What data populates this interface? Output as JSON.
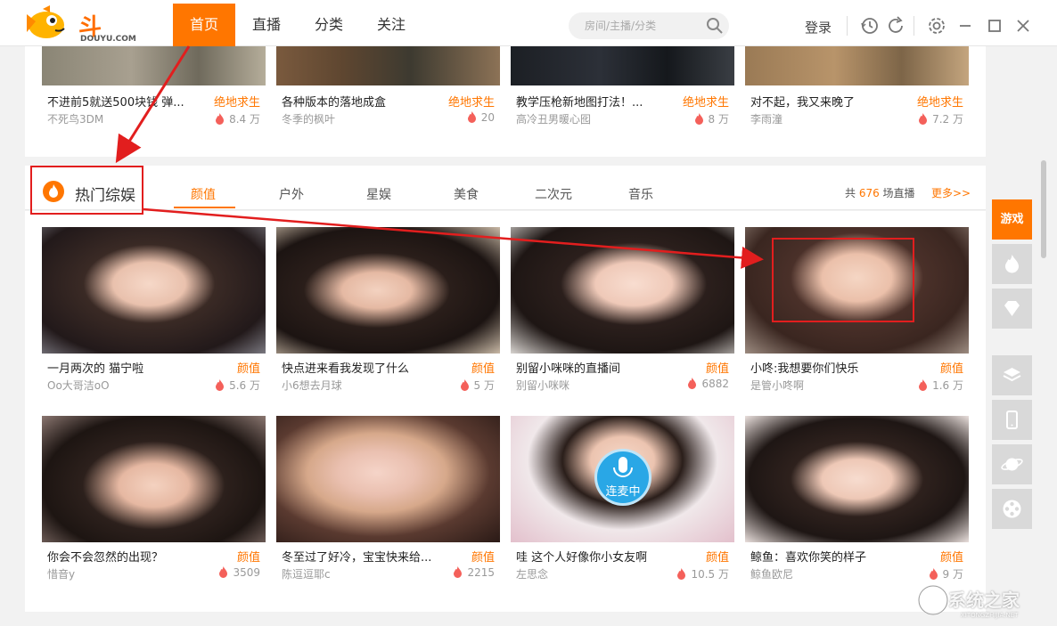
{
  "header": {
    "logo_text": "斗鱼",
    "logo_sub": "DOUYU.COM",
    "nav": [
      {
        "label": "首页",
        "active": true
      },
      {
        "label": "直播",
        "active": false
      },
      {
        "label": "分类",
        "active": false
      },
      {
        "label": "关注",
        "active": false
      }
    ],
    "search_placeholder": "房间/主播/分类",
    "login": "登录"
  },
  "top_row": [
    {
      "title": "不进前5就送500块钱 弹...",
      "category": "绝地求生",
      "user": "不死鸟3DM",
      "views": "8.4 万"
    },
    {
      "title": "各种版本的落地成盒",
      "category": "绝地求生",
      "user": "冬季的枫叶",
      "views": "20"
    },
    {
      "title": "教学压枪新地图打法！...",
      "category": "绝地求生",
      "user": "高冷丑男暖心囮",
      "views": "8 万"
    },
    {
      "title": "对不起，我又来晚了",
      "category": "绝地求生",
      "user": "李雨潼",
      "views": "7.2 万"
    }
  ],
  "section": {
    "title": "热门综娱",
    "tabs": [
      "颜值",
      "户外",
      "星娱",
      "美食",
      "二次元",
      "音乐"
    ],
    "active_tab": "颜值",
    "count_prefix": "共 ",
    "count": "676",
    "count_suffix": " 场直播",
    "more": "更多>>"
  },
  "cards": [
    {
      "title": "一月两次的 猫宁啦",
      "category": "颜值",
      "user": "Oo大哥洁oO",
      "views": "5.6 万"
    },
    {
      "title": "快点进来看我发现了什么",
      "category": "颜值",
      "user": "小6想去月球",
      "views": "5 万"
    },
    {
      "title": "别留小咪咪的直播间",
      "category": "颜值",
      "user": "别留小咪咪",
      "views": "6882"
    },
    {
      "title": "小咚:我想要你们快乐",
      "category": "颜值",
      "user": "是管小咚啊",
      "views": "1.6 万"
    },
    {
      "title": "你会不会忽然的出现？",
      "category": "颜值",
      "user": "惜音y",
      "views": "3509"
    },
    {
      "title": "冬至过了好冷，宝宝快来给...",
      "category": "颜值",
      "user": "陈逗逗耶c",
      "views": "2215"
    },
    {
      "title": "哇 这个人好像你小女友啊",
      "category": "颜值",
      "user": "左思念",
      "views": "10.5 万"
    },
    {
      "title": "鲸鱼：喜欢你笑的样子",
      "category": "颜值",
      "user": "鲸鱼欧尼",
      "views": "9 万"
    }
  ],
  "mic_badge": "连麦中",
  "sidebar": {
    "game_label": "游戏",
    "icons": [
      "flame-icon",
      "diamond-icon",
      "layers-icon",
      "mobile-icon",
      "planet-icon",
      "film-icon"
    ]
  },
  "watermark": {
    "text": "系统之家",
    "sub": "XITONGZHIJIA.NET"
  },
  "colors": {
    "accent": "#ff7600",
    "annotation": "#e21e1e"
  }
}
